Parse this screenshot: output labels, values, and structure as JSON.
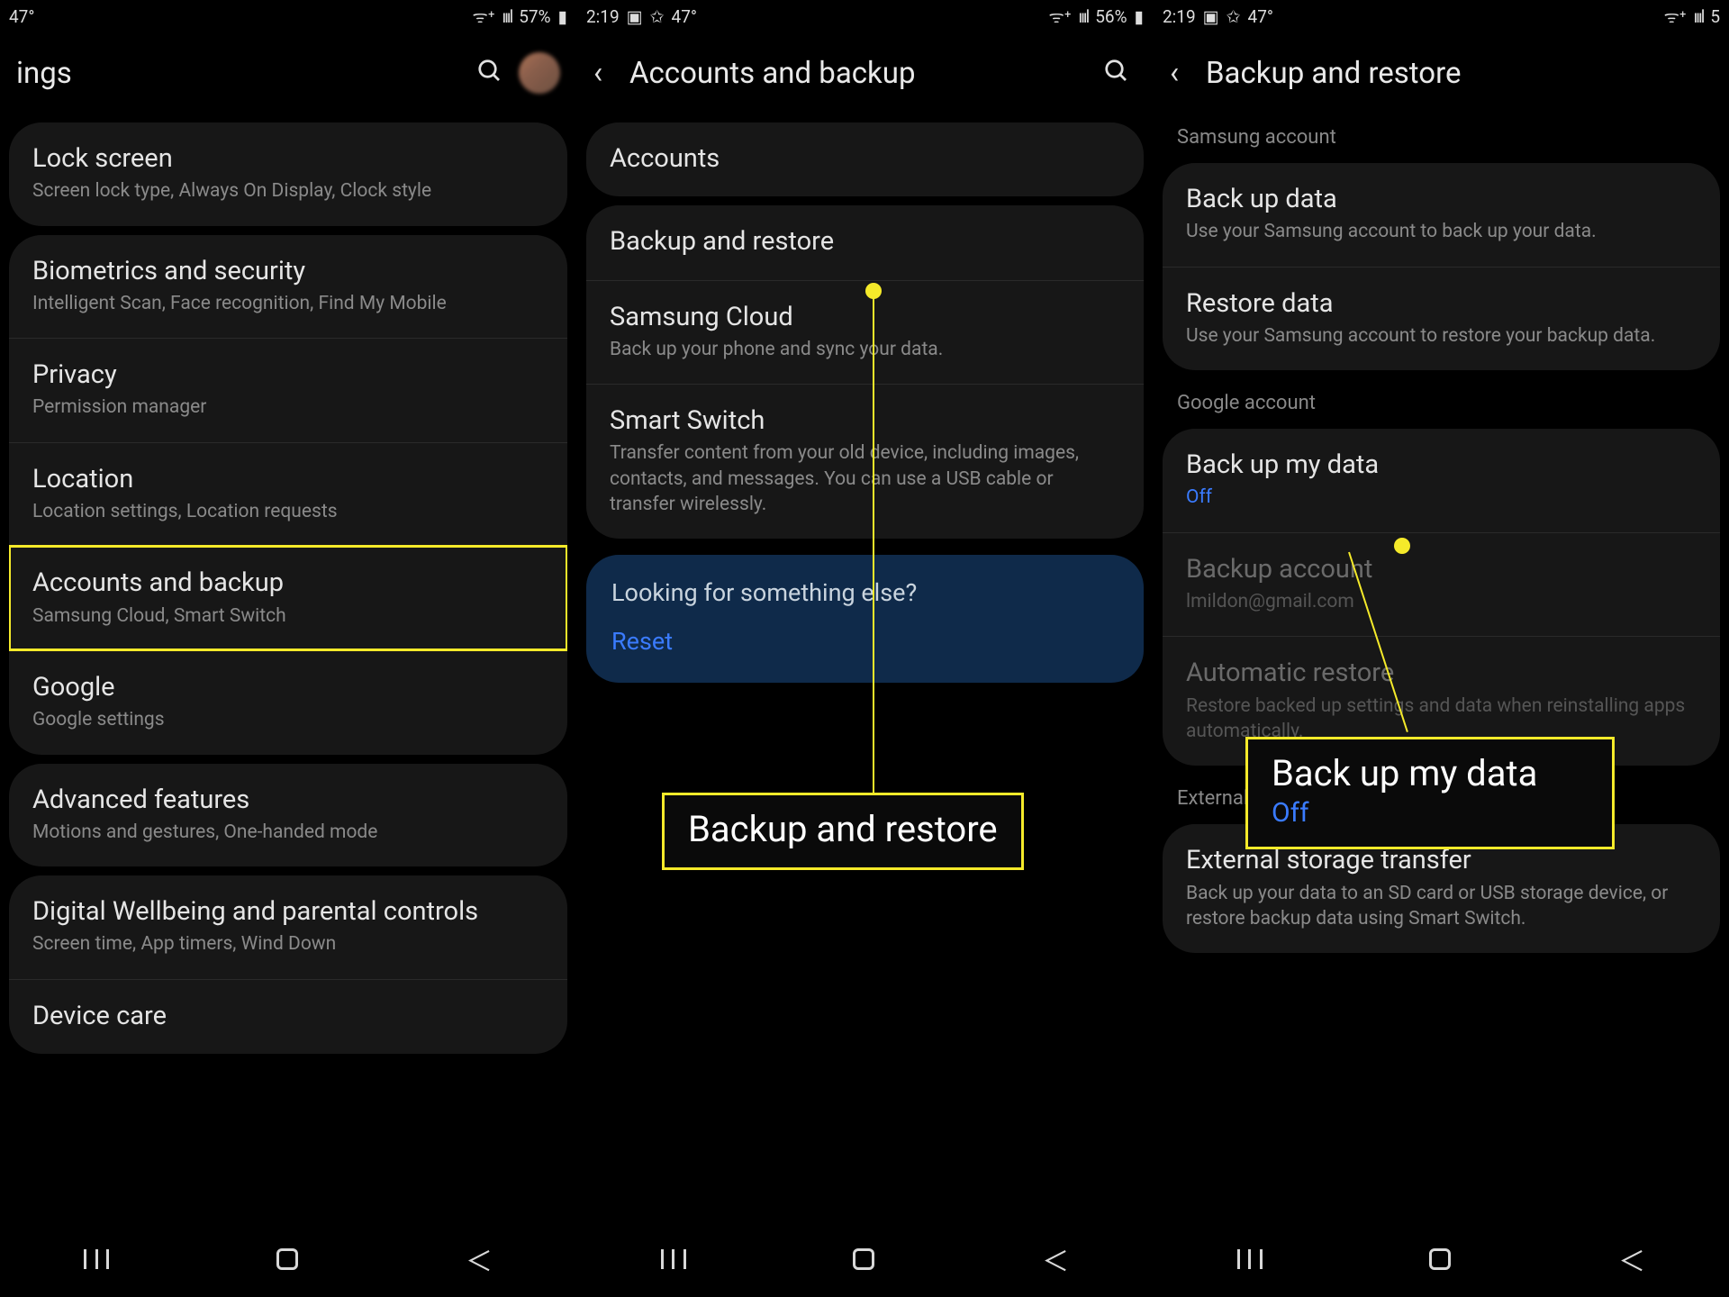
{
  "screen1": {
    "status": {
      "temp": "47°",
      "battery": "57%",
      "signal": "⁺ ᯤ ▮▮ıl"
    },
    "title": "ings",
    "items": [
      {
        "t": "Lock screen",
        "s": "Screen lock type, Always On Display, Clock style"
      },
      {
        "t": "Biometrics and security",
        "s": "Intelligent Scan, Face recognition, Find My Mobile"
      },
      {
        "t": "Privacy",
        "s": "Permission manager"
      },
      {
        "t": "Location",
        "s": "Location settings, Location requests"
      },
      {
        "t": "Accounts and backup",
        "s": "Samsung Cloud, Smart Switch",
        "hl": true
      },
      {
        "t": "Google",
        "s": "Google settings"
      },
      {
        "t": "Advanced features",
        "s": "Motions and gestures, One-handed mode"
      },
      {
        "t": "Digital Wellbeing and parental controls",
        "s": "Screen time, App timers, Wind Down"
      },
      {
        "t": "Device care",
        "s": ""
      }
    ]
  },
  "screen2": {
    "status": {
      "time": "2:19",
      "temp": "47°",
      "battery": "56%"
    },
    "title": "Accounts and backup",
    "group1": [
      {
        "t": "Accounts"
      }
    ],
    "group2": [
      {
        "t": "Backup and restore"
      },
      {
        "t": "Samsung Cloud",
        "s": "Back up your phone and sync your data."
      },
      {
        "t": "Smart Switch",
        "s": "Transfer content from your old device, including images, contacts, and messages. You can use a USB cable or transfer wirelessly."
      }
    ],
    "info_q": "Looking for something else?",
    "info_a": "Reset",
    "callout": "Backup and restore"
  },
  "screen3": {
    "status": {
      "time": "2:19",
      "temp": "47°"
    },
    "title": "Backup and restore",
    "sec1_label": "Samsung account",
    "sec1": [
      {
        "t": "Back up data",
        "s": "Use your Samsung account to back up your data."
      },
      {
        "t": "Restore data",
        "s": "Use your Samsung account to restore your backup data."
      }
    ],
    "sec2_label": "Google account",
    "sec2": [
      {
        "t": "Back up my data",
        "s": "Off",
        "link": true
      },
      {
        "t": "Backup account",
        "s": "lmildon@gmail.com",
        "link": true,
        "disabled": true
      },
      {
        "t": "Automatic restore",
        "s": "Restore backed up settings and data when reinstalling apps automatically.",
        "disabled": true
      }
    ],
    "sec3_label": "External storage",
    "sec3": [
      {
        "t": "External storage transfer",
        "s": "Back up your data to an SD card or USB storage device, or restore backup data using Smart Switch."
      }
    ],
    "callout_t": "Back up my data",
    "callout_s": "Off"
  }
}
